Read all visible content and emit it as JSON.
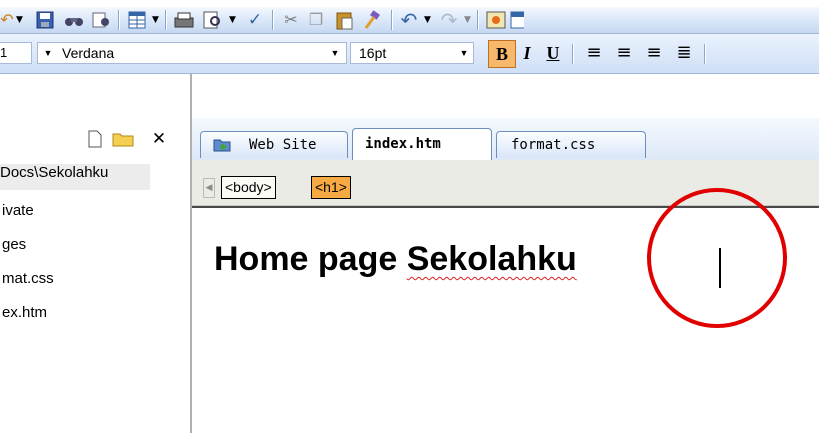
{
  "toolbar": {
    "icons": [
      "undo-icon",
      "save-icon",
      "find-icon",
      "spell-icon",
      "table-icon",
      "print-icon",
      "preview-icon",
      "spellcheck-icon",
      "cut-icon",
      "copy-icon",
      "paste-icon",
      "format-painter-icon",
      "undo-icon",
      "redo-icon",
      "image-icon",
      "table-insert-icon"
    ],
    "font_name": "Verdana",
    "font_size": "16pt",
    "size_left_fragment": "1",
    "bold": "B",
    "italic": "I",
    "underline": "U"
  },
  "panel": {
    "items": [
      "Docs\\Sekolahku",
      "ivate",
      "ges",
      "mat.css",
      "ex.htm"
    ]
  },
  "tabs": [
    {
      "label": "Web Site",
      "active": false
    },
    {
      "label": "index.htm",
      "active": true
    },
    {
      "label": "format.css",
      "active": false
    }
  ],
  "breadcrumb": {
    "tags": [
      "<body>",
      "<h1>"
    ]
  },
  "editor": {
    "heading_text_plain": "Home page ",
    "heading_text_misspelled": "Sekolahku"
  },
  "colors": {
    "toolbar_bg": "#dde9f9",
    "highlight_tag": "#f7a944",
    "circle": "#e00000"
  }
}
